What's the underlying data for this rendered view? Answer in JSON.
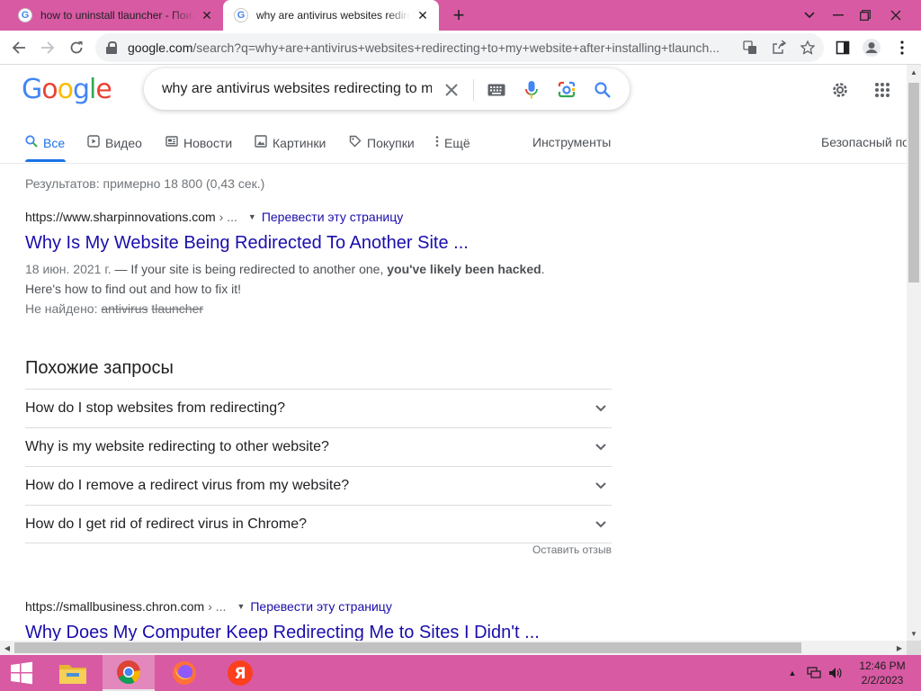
{
  "browser": {
    "tabs": [
      {
        "title": "how to uninstall tlauncher - Поиск в Google",
        "favicon": "G",
        "close": "✕"
      },
      {
        "title": "why are antivirus websites redirecting to my website",
        "favicon": "G",
        "close": "✕"
      }
    ],
    "new_tab": "+",
    "window_controls": {
      "dropdown": "⌄",
      "minimize": "—",
      "restore": "❐",
      "close": "✕"
    },
    "url_host": "google.com",
    "url_path": "/search?q=why+are+antivirus+websites+redirecting+to+my+website+after+installing+tlaunch..."
  },
  "google": {
    "logo": [
      "G",
      "o",
      "o",
      "g",
      "l",
      "e"
    ],
    "search_value": "why are antivirus websites redirecting to my website after installing tlauncher",
    "clear": "✕",
    "tabs": [
      {
        "label": "Все",
        "icon": "search-icon",
        "active": true
      },
      {
        "label": "Видео",
        "icon": "play-icon"
      },
      {
        "label": "Новости",
        "icon": "news-icon"
      },
      {
        "label": "Картинки",
        "icon": "image-icon"
      },
      {
        "label": "Покупки",
        "icon": "tag-icon"
      },
      {
        "label": "Ещё",
        "icon": "more-vert-icon"
      },
      {
        "label": "Инструменты",
        "icon": ""
      },
      {
        "label": "Безопасный поиск",
        "icon": ""
      }
    ],
    "stats": "Результатов: примерно 18 800 (0,43 сек.)",
    "results": [
      {
        "site": "https://www.sharpinnovations.com",
        "path": "› ...",
        "translate": "Перевести эту страницу",
        "title": "Why Is My Website Being Redirected To Another Site ...",
        "date": "18 июн. 2021 г.",
        "snippet_pre": " — If your site is being redirected to another one, ",
        "snippet_bold": "you've likely been hacked",
        "snippet_post": ".",
        "snippet_line2": "Here's how to find out and how to fix it!",
        "missing_label": "Не найдено:",
        "missing_terms": [
          "antivirus",
          "tlauncher"
        ]
      },
      {
        "site": "https://smallbusiness.chron.com",
        "path": "› ...",
        "translate": "Перевести эту страницу",
        "title": "Why Does My Computer Keep Redirecting Me to Sites I Didn't ..."
      }
    ],
    "related": {
      "heading": "Похожие запросы",
      "items": [
        "How do I stop websites from redirecting?",
        "Why is my website redirecting to other website?",
        "How do I remove a redirect virus from my website?",
        "How do I get rid of redirect virus in Chrome?"
      ],
      "feedback": "Оставить отзыв"
    }
  },
  "taskbar": {
    "time": "12:46 PM",
    "date": "2/2/2023",
    "apps": [
      "windows-start",
      "file-explorer",
      "chrome",
      "firefox",
      "yandex-browser"
    ],
    "yandex_glyph": "Я",
    "tray_up": "▲"
  },
  "colors": {
    "titlebar": "#d85aa3",
    "link": "#1a0dab",
    "accent": "#1a73e8"
  }
}
